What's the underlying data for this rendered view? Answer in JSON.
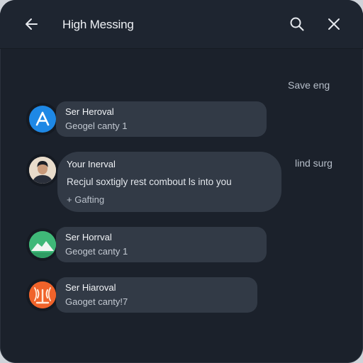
{
  "header": {
    "title": "High Messing",
    "back_icon": "arrow-left-icon",
    "search_icon": "search-icon",
    "close_icon": "close-icon"
  },
  "status_labels": [
    "Save eng",
    "lind surg"
  ],
  "messages": [
    {
      "name": "Ser Heroval",
      "sub": "Geogel canty 1",
      "avatar_icon": "app-store-icon",
      "avatar_color": "#1e88e5"
    },
    {
      "name": "Your Inerval",
      "body": "Recjul soxtigly rest combout ls into you",
      "footer": "+ Gafting",
      "avatar_icon": "person-photo-avatar"
    },
    {
      "name": "Ser Horrval",
      "sub": "Geoget canty 1",
      "avatar_icon": "mountain-icon",
      "avatar_color": "#3fb878"
    },
    {
      "name": "Ser Hiaroval",
      "sub": "Gaoget canty!7",
      "avatar_icon": "antenna-icon",
      "avatar_color": "#f0632a"
    }
  ],
  "colors": {
    "background": "#1b212b",
    "header": "#1e2530",
    "bubble": "#323a46"
  }
}
